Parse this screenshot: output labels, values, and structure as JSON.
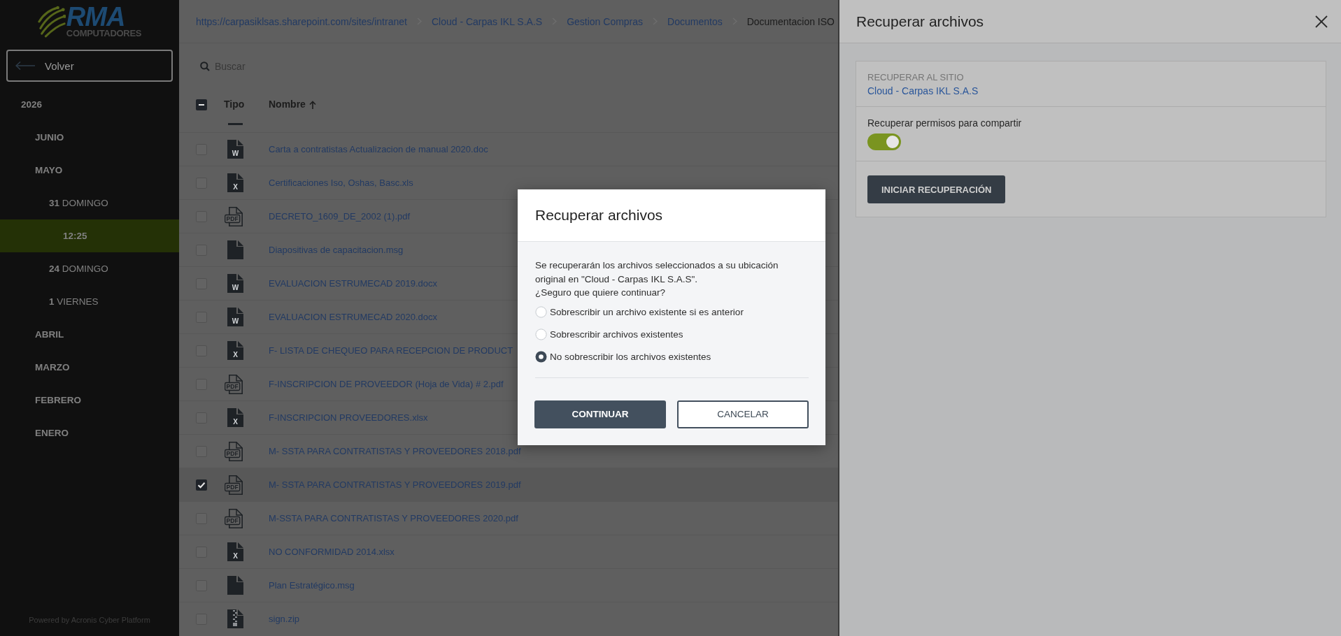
{
  "sidebar": {
    "logo": {
      "title": "RMA",
      "subtitle": "COMPUTADORES"
    },
    "back_button": "Volver",
    "tree": [
      {
        "label": "2026",
        "kind": "year",
        "selected": false,
        "children": [
          {
            "label": "JUNIO",
            "kind": "month",
            "selected": false
          },
          {
            "label": "MAYO",
            "kind": "month",
            "selected": false,
            "children": [
              {
                "label": "**31** DOMINGO",
                "kind": "day",
                "selected": false,
                "children": [
                  {
                    "label": "12:25",
                    "kind": "time",
                    "selected": true
                  }
                ]
              },
              {
                "label": "**24** DOMINGO",
                "kind": "day",
                "selected": false
              },
              {
                "label": "**1** VIERNES",
                "kind": "day",
                "selected": false
              }
            ]
          },
          {
            "label": "ABRIL",
            "kind": "month",
            "selected": false
          },
          {
            "label": "MARZO",
            "kind": "month",
            "selected": false
          },
          {
            "label": "FEBRERO",
            "kind": "month",
            "selected": false
          },
          {
            "label": "ENERO",
            "kind": "month",
            "selected": false
          }
        ]
      }
    ],
    "footer": "Powered by Acronis Cyber Platform"
  },
  "breadcrumb": [
    {
      "label": "https://carpasiklsas.sharepoint.com/sites/intranet",
      "current": false
    },
    {
      "label": "Cloud - Carpas IKL S.A.S",
      "current": false
    },
    {
      "label": "Gestion Compras",
      "current": false
    },
    {
      "label": "Documentos",
      "current": false
    },
    {
      "label": "Documentacion ISO",
      "current": true
    }
  ],
  "search": {
    "placeholder": "Buscar"
  },
  "table": {
    "select_all": {
      "indeterminate": true
    },
    "columns": [
      {
        "label": "Tipo",
        "sorted": false
      },
      {
        "label": "Nombre",
        "sorted": true
      }
    ],
    "rows": [
      {
        "name": "Carta a contratistas Actualizacion de manual 2020.doc",
        "kind": "word",
        "icon_label": "W",
        "checked": false
      },
      {
        "name": "Certificaciones Iso, Oshas, Basc.xls",
        "kind": "excel",
        "icon_label": "X",
        "checked": false
      },
      {
        "name": "DECRETO_1609_DE_2002 (1).pdf",
        "kind": "pdf",
        "icon_label": "PDF",
        "checked": false
      },
      {
        "name": "Diapositivas de capacitacion.msg",
        "kind": "file",
        "checked": false
      },
      {
        "name": "EVALUACION ESTRUMECAD 2019.docx",
        "kind": "word",
        "icon_label": "W",
        "checked": false
      },
      {
        "name": "EVALUACION ESTRUMECAD 2020.docx",
        "kind": "word",
        "icon_label": "W",
        "checked": false
      },
      {
        "name": "F- LISTA DE CHEQUEO PARA RECEPCION DE PRODUCT",
        "kind": "excel",
        "icon_label": "X",
        "checked": false
      },
      {
        "name": "F-INSCRIPCION DE PROVEEDOR (Hoja de Vida) # 2.pdf",
        "kind": "pdf",
        "icon_label": "PDF",
        "checked": false
      },
      {
        "name": "F-INSCRIPCION PROVEEDORES.xlsx",
        "kind": "excel",
        "icon_label": "X",
        "checked": false
      },
      {
        "name": "M- SSTA PARA CONTRATISTAS Y PROVEEDORES 2018.pdf",
        "kind": "pdf",
        "icon_label": "PDF",
        "checked": false
      },
      {
        "name": "M- SSTA PARA CONTRATISTAS Y PROVEEDORES 2019.pdf",
        "kind": "pdf",
        "icon_label": "PDF",
        "checked": true
      },
      {
        "name": "M-SSTA PARA CONTRATISTAS Y PROVEEDORES 2020.pdf",
        "kind": "pdf",
        "icon_label": "PDF",
        "checked": false
      },
      {
        "name": "NO CONFORMIDAD 2014.xlsx",
        "kind": "excel",
        "icon_label": "X",
        "checked": false
      },
      {
        "name": "Plan Estratégico.msg",
        "kind": "file",
        "checked": false
      },
      {
        "name": "sign.zip",
        "kind": "zip",
        "checked": false
      }
    ]
  },
  "side_panel": {
    "title": "Recuperar archivos",
    "target_label": "RECUPERAR AL SITIO",
    "target_site": "Cloud - Carpas IKL S.A.S",
    "permissions": {
      "label": "Recuperar permisos para compartir",
      "on": true
    },
    "button": "INICIAR RECUPERACIÓN"
  },
  "dialog": {
    "title": "Recuperar archivos",
    "message": "Se recuperarán los archivos seleccionados a su ubicación original en \"Cloud - Carpas IKL S.A.S\".",
    "question": "¿Seguro que quiere continuar?",
    "options": [
      {
        "label": "Sobrescribir un archivo existente si es anterior",
        "selected": false
      },
      {
        "label": "Sobrescribir archivos existentes",
        "selected": false
      },
      {
        "label": "No sobrescribir los archivos existentes",
        "selected": true
      }
    ],
    "buttons": [
      {
        "label": "CONTINUAR",
        "kind": "primary"
      },
      {
        "label": "CANCELAR",
        "kind": "secondary"
      }
    ]
  }
}
